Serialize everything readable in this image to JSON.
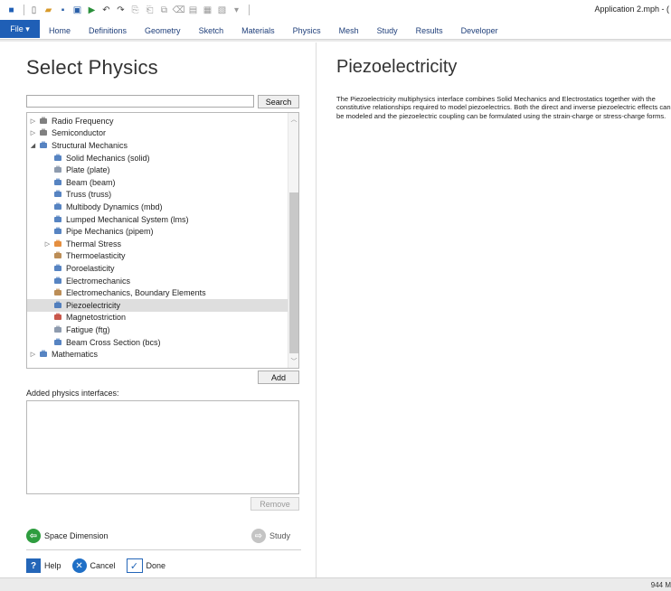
{
  "app": {
    "title": "Application 2.mph - ("
  },
  "quick_access": [
    {
      "icon": "app-icon"
    },
    {
      "icon": "new-icon"
    },
    {
      "icon": "open-icon"
    },
    {
      "icon": "save-icon"
    },
    {
      "icon": "save-as-icon"
    },
    {
      "icon": "run-icon"
    },
    {
      "icon": "undo-icon"
    },
    {
      "icon": "redo-icon"
    },
    {
      "icon": "copy-icon"
    },
    {
      "icon": "paste-icon"
    },
    {
      "icon": "duplicate-icon"
    },
    {
      "icon": "delete-icon"
    },
    {
      "icon": "compact-history-icon"
    },
    {
      "icon": "compile-icon"
    },
    {
      "icon": "windows-icon"
    }
  ],
  "ribbon": {
    "file_label": "File ▾",
    "tabs": [
      "Home",
      "Definitions",
      "Geometry",
      "Sketch",
      "Materials",
      "Physics",
      "Mesh",
      "Study",
      "Results",
      "Developer"
    ]
  },
  "select_physics": {
    "title": "Select Physics",
    "search_value": "",
    "search_button": "Search",
    "tree": [
      {
        "label": "Radio Frequency",
        "indent": 0,
        "expander": "▷",
        "icon": "radio-frequency-icon",
        "color": "#6a6a6a"
      },
      {
        "label": "Semiconductor",
        "indent": 0,
        "expander": "▷",
        "icon": "semiconductor-icon",
        "color": "#6a6a6a"
      },
      {
        "label": "Structural Mechanics",
        "indent": 0,
        "expander": "◢",
        "icon": "structural-mechanics-icon",
        "color": "#3a6fb7"
      },
      {
        "label": "Solid Mechanics (solid)",
        "indent": 1,
        "expander": "",
        "icon": "solid-mechanics-icon",
        "color": "#3a6fb7"
      },
      {
        "label": "Plate (plate)",
        "indent": 1,
        "expander": "",
        "icon": "plate-icon",
        "color": "#7a8aa0"
      },
      {
        "label": "Beam (beam)",
        "indent": 1,
        "expander": "",
        "icon": "beam-icon",
        "color": "#3a6fb7"
      },
      {
        "label": "Truss (truss)",
        "indent": 1,
        "expander": "",
        "icon": "truss-icon",
        "color": "#3a6fb7"
      },
      {
        "label": "Multibody Dynamics (mbd)",
        "indent": 1,
        "expander": "",
        "icon": "multibody-dynamics-icon",
        "color": "#3a6fb7"
      },
      {
        "label": "Lumped Mechanical System (lms)",
        "indent": 1,
        "expander": "",
        "icon": "lumped-mechanical-system-icon",
        "color": "#3a6fb7"
      },
      {
        "label": "Pipe Mechanics (pipem)",
        "indent": 1,
        "expander": "",
        "icon": "pipe-mechanics-icon",
        "color": "#3a6fb7"
      },
      {
        "label": "Thermal Stress",
        "indent": 1,
        "expander": "▷",
        "icon": "thermal-stress-icon",
        "color": "#e07b1f"
      },
      {
        "label": "Thermoelasticity",
        "indent": 1,
        "expander": "",
        "icon": "thermoelasticity-icon",
        "color": "#b07a3a"
      },
      {
        "label": "Poroelasticity",
        "indent": 1,
        "expander": "",
        "icon": "poroelasticity-icon",
        "color": "#3a6fb7"
      },
      {
        "label": "Electromechanics",
        "indent": 1,
        "expander": "",
        "icon": "electromechanics-icon",
        "color": "#3a6fb7"
      },
      {
        "label": "Electromechanics, Boundary Elements",
        "indent": 1,
        "expander": "",
        "icon": "electromechanics-boundary-elements-icon",
        "color": "#b07a3a"
      },
      {
        "label": "Piezoelectricity",
        "indent": 1,
        "expander": "",
        "icon": "piezoelectricity-icon",
        "color": "#3a6fb7",
        "selected": true
      },
      {
        "label": "Magnetostriction",
        "indent": 1,
        "expander": "",
        "icon": "magnetostriction-icon",
        "color": "#c0392b"
      },
      {
        "label": "Fatigue (ftg)",
        "indent": 1,
        "expander": "",
        "icon": "fatigue-icon",
        "color": "#7a8aa0"
      },
      {
        "label": "Beam Cross Section (bcs)",
        "indent": 1,
        "expander": "",
        "icon": "beam-cross-section-icon",
        "color": "#3a6fb7"
      },
      {
        "label": "Mathematics",
        "indent": 0,
        "expander": "▷",
        "icon": "mathematics-icon",
        "color": "#3a6fb7"
      }
    ],
    "add_button": "Add",
    "added_label": "Added physics interfaces:",
    "remove_button": "Remove",
    "space_dimension": "Space Dimension",
    "study": "Study",
    "help": "Help",
    "cancel": "Cancel",
    "done": "Done"
  },
  "description": {
    "title": "Piezoelectricity",
    "text": "The Piezoelectricity multiphysics interface combines Solid Mechanics and Electrostatics together with the constitutive relationships required to model piezoelectrics. Both the direct and inverse piezoelectric effects can be modeled and the piezoelectric coupling can be formulated using the strain-charge or stress-charge forms."
  },
  "status_bar": {
    "memory": "944 M"
  },
  "colors": {
    "file_tab": "#1f5fb6",
    "back_green": "#2e9d3f",
    "cancel_blue": "#1f6fc6",
    "help_blue": "#2466b8"
  }
}
